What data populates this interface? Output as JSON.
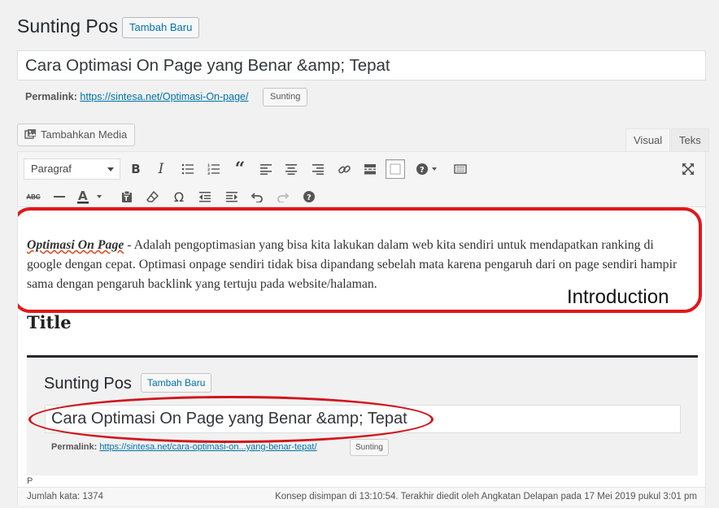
{
  "header": {
    "title": "Sunting Pos",
    "add_new_label": "Tambah Baru"
  },
  "post": {
    "title": "Cara Optimasi On Page yang Benar &amp; Tepat"
  },
  "permalink": {
    "label": "Permalink:",
    "url": "https://sintesa.net/Optimasi-On-page/",
    "edit_label": "Sunting"
  },
  "media": {
    "add_media_label": "Tambahkan Media"
  },
  "editor_tabs": {
    "visual": "Visual",
    "text": "Teks"
  },
  "toolbar": {
    "format_select": "Paragraf",
    "row1_icons": [
      "bold-icon",
      "italic-icon",
      "bullet-list-icon",
      "numbered-list-icon",
      "blockquote-icon",
      "align-left-icon",
      "align-center-icon",
      "align-right-icon",
      "link-icon",
      "read-more-icon",
      "toolbar-toggle-icon",
      "help-icon",
      "distraction-free-icon",
      "fullscreen-icon"
    ],
    "row2_icons": [
      "strikethrough-icon",
      "horizontal-line-icon",
      "text-color-icon",
      "paste-text-icon",
      "clear-formatting-icon",
      "special-character-icon",
      "outdent-icon",
      "indent-icon",
      "undo-icon",
      "redo-icon",
      "keyboard-shortcuts-icon"
    ]
  },
  "content": {
    "lead": "Optimasi On Page",
    "paragraph_rest": " - Adalah pengoptimasian yang bisa kita lakukan dalam web kita sendiri untuk mendapatkan ranking di google dengan cepat. Optimasi onpage sendiri tidak bisa dipandang sebelah mata karena pengaruh dari on page sendiri hampir sama dengan pengaruh backlink yang tertuju pada website/halaman.",
    "annotation_label": "Introduction",
    "heading": "Title"
  },
  "embedded_screenshot": {
    "title": "Sunting Pos",
    "add_new_label": "Tambah Baru",
    "post_title": "Cara Optimasi On Page yang Benar &amp; Tepat",
    "permalink_label": "Permalink:",
    "permalink_url": "https://sintesa.net/cara-optimasi-on...yang-benar-tepat/",
    "edit_label": "Sunting"
  },
  "status": {
    "path": "P",
    "word_count": "Jumlah kata: 1374",
    "saved": "Konsep disimpan di 13:10:54. Terakhir diedit oleh Angkatan Delapan pada 17 Mei 2019 pukul 3:01 pm"
  },
  "colors": {
    "link": "#0073aa",
    "annotation_red": "#e0181b"
  }
}
